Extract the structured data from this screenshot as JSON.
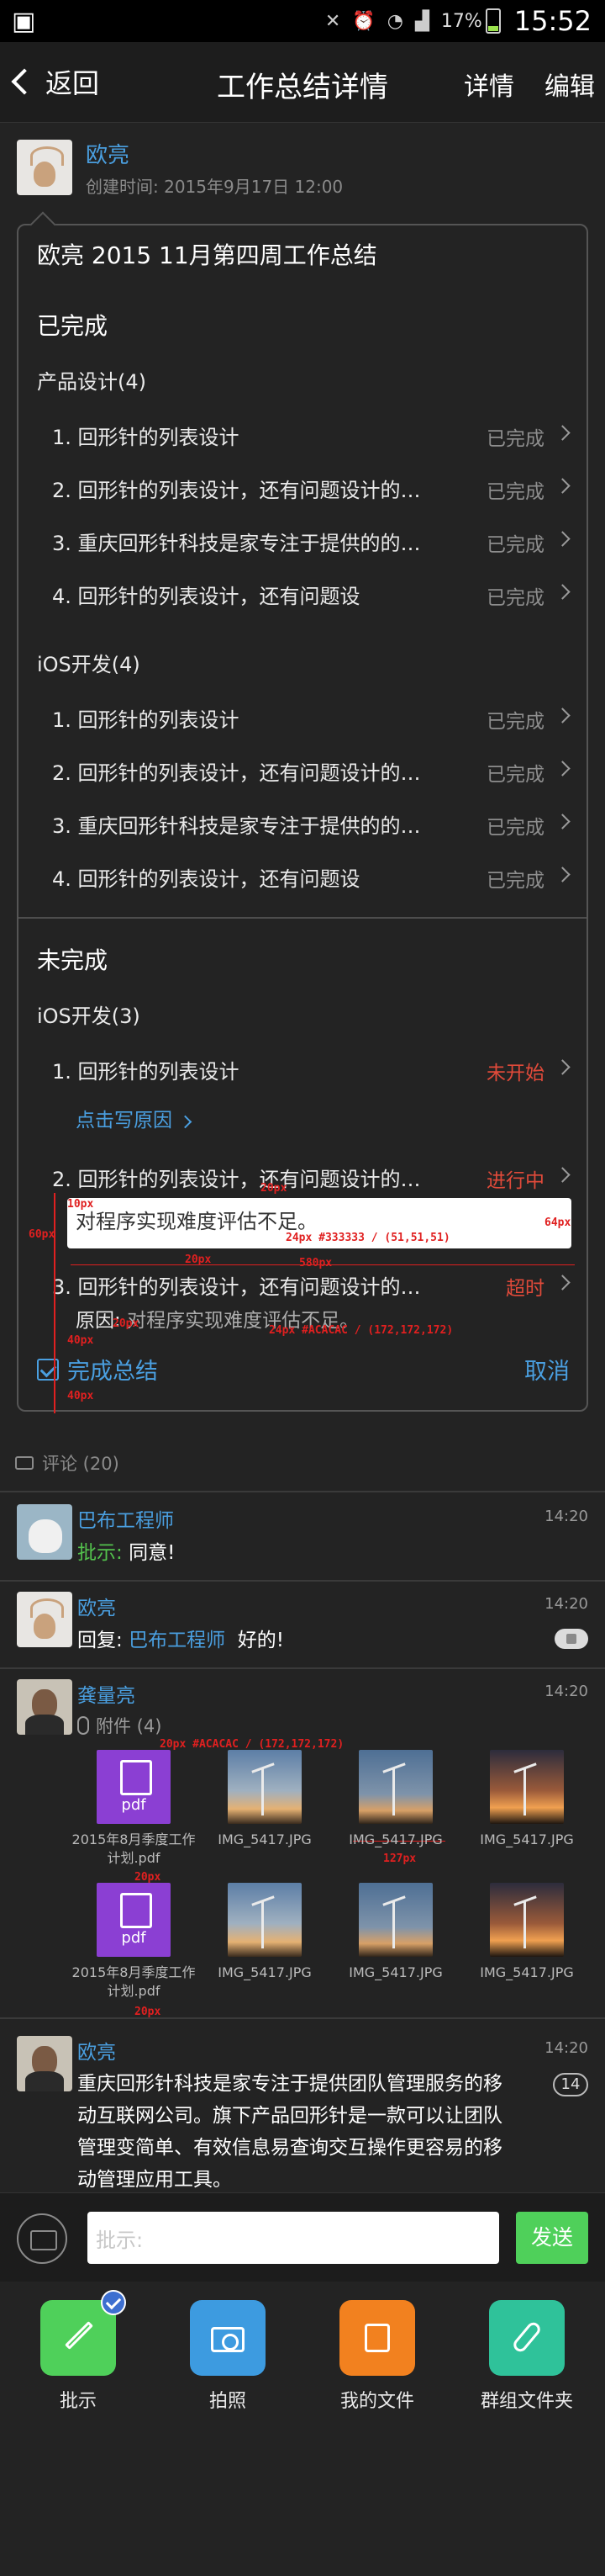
{
  "status_bar": {
    "time": "15:52",
    "battery": "17%"
  },
  "nav": {
    "back": "返回",
    "title": "工作总结详情",
    "detail": "详情",
    "edit": "编辑"
  },
  "author": {
    "name": "欧亮",
    "time": "创建时间: 2015年9月17日  12:00"
  },
  "summary": {
    "title": "欧亮 2015 11月第四周工作总结",
    "done_title": "已完成",
    "done_groups": [
      {
        "name": "产品设计(4)",
        "items": [
          {
            "text": "1. 回形针的列表设计",
            "status": "已完成"
          },
          {
            "text": "2. 回形针的列表设计，还有问题设计的细...",
            "status": "已完成"
          },
          {
            "text": "3. 重庆回形针科技是家专注于提供的的细...",
            "status": "已完成"
          },
          {
            "text": "4. 回形针的列表设计，还有问题设",
            "status": "已完成"
          }
        ]
      },
      {
        "name": "iOS开发(4)",
        "items": [
          {
            "text": "1. 回形针的列表设计",
            "status": "已完成"
          },
          {
            "text": "2. 回形针的列表设计，还有问题设计的细...",
            "status": "已完成"
          },
          {
            "text": "3. 重庆回形针科技是家专注于提供的的细...",
            "status": "已完成"
          },
          {
            "text": "4. 回形针的列表设计，还有问题设",
            "status": "已完成"
          }
        ]
      }
    ],
    "undone_title": "未完成",
    "undone_group": "iOS开发(3)",
    "undone_items": [
      {
        "text": "1. 回形针的列表设计",
        "status": "未开始"
      },
      {
        "text": "2. 回形针的列表设计，还有问题设计的细...",
        "status": "进行中"
      },
      {
        "text": "3. 回形针的列表设计，还有问题设计的细...",
        "status": "超时"
      }
    ],
    "write_reason": "点击写原因",
    "reason_input_value": "对程序实现难度评估不足。",
    "reason_label": "原因: ",
    "reason_value": "对程序实现难度评估不足。",
    "finish_label": "完成总结",
    "cancel_label": "取消"
  },
  "comments_header": "评论 (20)",
  "comments": [
    {
      "name": "巴布工程师",
      "time": "14:20",
      "tag": "批示: ",
      "body": "同意!"
    },
    {
      "name": "欧亮",
      "time": "14:20",
      "prefix": "回复: ",
      "mention": "巴布工程师",
      "body": "好的!"
    },
    {
      "name": "龚量亮",
      "time": "14:20",
      "attach_label": "附件 (4)",
      "files": [
        {
          "name": "2015年8月季度工作计划.pdf",
          "type": "pdf",
          "badge": "pdf"
        },
        {
          "name": "IMG_5417.JPG",
          "type": "photo"
        },
        {
          "name": "IMG_5417.JPG",
          "type": "photo"
        },
        {
          "name": "IMG_5417.JPG",
          "type": "photo"
        },
        {
          "name": "2015年8月季度工作计划.pdf",
          "type": "pdf",
          "badge": "pdf"
        },
        {
          "name": "IMG_5417.JPG",
          "type": "photo"
        },
        {
          "name": "IMG_5417.JPG",
          "type": "photo"
        },
        {
          "name": "IMG_5417.JPG",
          "type": "photo"
        }
      ]
    },
    {
      "name": "欧亮",
      "time": "14:20",
      "count": "14",
      "body_lines": [
        "重庆回形针科技是家专注于提供团队管理服务的移",
        "动互联网公司。旗下产品回形针是一款可以让团队",
        "管理变简单、有效信息易查询交互操作更容易的移",
        "动管理应用工具。"
      ]
    }
  ],
  "input": {
    "placeholder": "批示:",
    "send": "发送"
  },
  "actions": [
    {
      "label": "批示",
      "icon": "pencil-icon",
      "color": "#4fd05a"
    },
    {
      "label": "拍照",
      "icon": "camera-icon",
      "color": "#3d9be0"
    },
    {
      "label": "我的文件",
      "icon": "document-icon",
      "color": "#f2811f"
    },
    {
      "label": "群组文件夹",
      "icon": "paperclip-icon",
      "color": "#2fc29a"
    }
  ],
  "annotations": {
    "a1": "10px",
    "a2": "20px",
    "a3": "60px",
    "a4": "24px #333333 / (51,51,51)",
    "a5": "64px",
    "a6": "20px",
    "a7": "580px",
    "a8": "40px",
    "a9": "20px",
    "a10": "24px #ACACAC / (172,172,172)",
    "a11": "40px",
    "a12": "20px #ACACAC / (172,172,172)",
    "a13": "20px",
    "a14": "127px",
    "a15": "20px"
  }
}
